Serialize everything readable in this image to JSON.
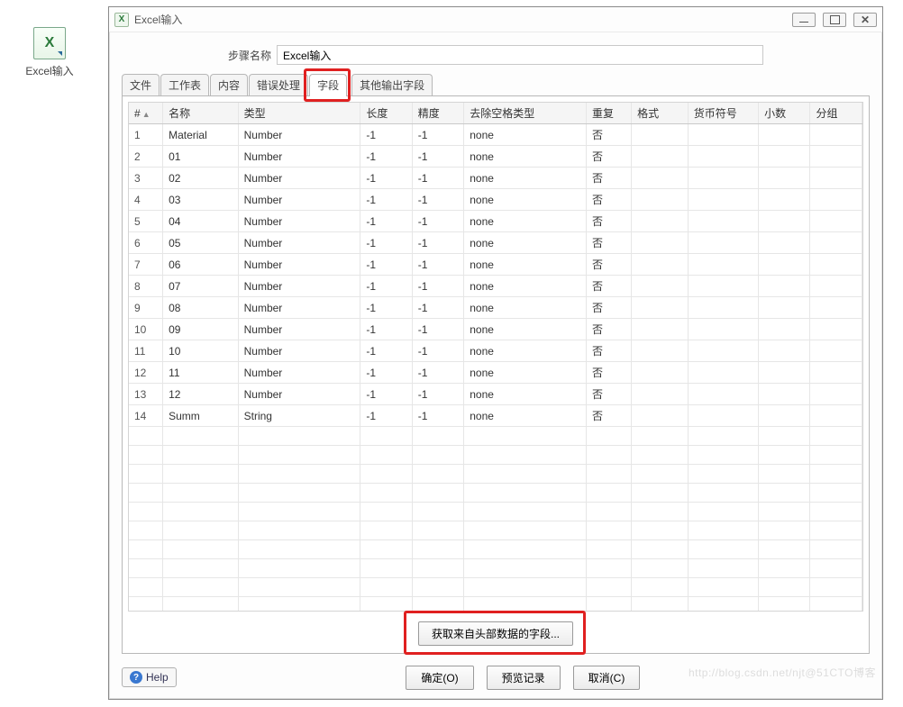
{
  "desktop": {
    "icon_label": "Excel输入",
    "icon_glyph": "X"
  },
  "window": {
    "title": "Excel输入",
    "step_label": "步骤名称",
    "step_value": "Excel输入"
  },
  "tabs": {
    "items": [
      {
        "label": "文件"
      },
      {
        "label": "工作表"
      },
      {
        "label": "内容"
      },
      {
        "label": "错误处理"
      },
      {
        "label": "字段",
        "active": true
      },
      {
        "label": "其他输出字段",
        "spaced": true
      }
    ]
  },
  "columns": {
    "idx": "#",
    "name": "名称",
    "type": "类型",
    "length": "长度",
    "precision": "精度",
    "trim": "去除空格类型",
    "repeat": "重复",
    "format": "格式",
    "currency": "货币符号",
    "decimal": "小数",
    "grouping": "分组"
  },
  "rows": [
    {
      "idx": "1",
      "name": "Material",
      "type": "Number",
      "length": "-1",
      "precision": "-1",
      "trim": "none",
      "repeat": "否",
      "format": "",
      "currency": "",
      "decimal": "",
      "grouping": ""
    },
    {
      "idx": "2",
      "name": "01",
      "type": "Number",
      "length": "-1",
      "precision": "-1",
      "trim": "none",
      "repeat": "否",
      "format": "",
      "currency": "",
      "decimal": "",
      "grouping": ""
    },
    {
      "idx": "3",
      "name": "02",
      "type": "Number",
      "length": "-1",
      "precision": "-1",
      "trim": "none",
      "repeat": "否",
      "format": "",
      "currency": "",
      "decimal": "",
      "grouping": ""
    },
    {
      "idx": "4",
      "name": "03",
      "type": "Number",
      "length": "-1",
      "precision": "-1",
      "trim": "none",
      "repeat": "否",
      "format": "",
      "currency": "",
      "decimal": "",
      "grouping": ""
    },
    {
      "idx": "5",
      "name": "04",
      "type": "Number",
      "length": "-1",
      "precision": "-1",
      "trim": "none",
      "repeat": "否",
      "format": "",
      "currency": "",
      "decimal": "",
      "grouping": ""
    },
    {
      "idx": "6",
      "name": "05",
      "type": "Number",
      "length": "-1",
      "precision": "-1",
      "trim": "none",
      "repeat": "否",
      "format": "",
      "currency": "",
      "decimal": "",
      "grouping": ""
    },
    {
      "idx": "7",
      "name": "06",
      "type": "Number",
      "length": "-1",
      "precision": "-1",
      "trim": "none",
      "repeat": "否",
      "format": "",
      "currency": "",
      "decimal": "",
      "grouping": ""
    },
    {
      "idx": "8",
      "name": "07",
      "type": "Number",
      "length": "-1",
      "precision": "-1",
      "trim": "none",
      "repeat": "否",
      "format": "",
      "currency": "",
      "decimal": "",
      "grouping": ""
    },
    {
      "idx": "9",
      "name": "08",
      "type": "Number",
      "length": "-1",
      "precision": "-1",
      "trim": "none",
      "repeat": "否",
      "format": "",
      "currency": "",
      "decimal": "",
      "grouping": ""
    },
    {
      "idx": "10",
      "name": "09",
      "type": "Number",
      "length": "-1",
      "precision": "-1",
      "trim": "none",
      "repeat": "否",
      "format": "",
      "currency": "",
      "decimal": "",
      "grouping": ""
    },
    {
      "idx": "11",
      "name": "10",
      "type": "Number",
      "length": "-1",
      "precision": "-1",
      "trim": "none",
      "repeat": "否",
      "format": "",
      "currency": "",
      "decimal": "",
      "grouping": ""
    },
    {
      "idx": "12",
      "name": "11",
      "type": "Number",
      "length": "-1",
      "precision": "-1",
      "trim": "none",
      "repeat": "否",
      "format": "",
      "currency": "",
      "decimal": "",
      "grouping": ""
    },
    {
      "idx": "13",
      "name": "12",
      "type": "Number",
      "length": "-1",
      "precision": "-1",
      "trim": "none",
      "repeat": "否",
      "format": "",
      "currency": "",
      "decimal": "",
      "grouping": ""
    },
    {
      "idx": "14",
      "name": "Summ",
      "type": "String",
      "length": "-1",
      "precision": "-1",
      "trim": "none",
      "repeat": "否",
      "format": "",
      "currency": "",
      "decimal": "",
      "grouping": ""
    }
  ],
  "empty_rows": 10,
  "buttons": {
    "fetch": "获取来自头部数据的字段...",
    "ok": "确定(O)",
    "preview": "预览记录",
    "cancel": "取消(C)",
    "help": "Help"
  },
  "watermark": "http://blog.csdn.net/njt@51CTO博客"
}
